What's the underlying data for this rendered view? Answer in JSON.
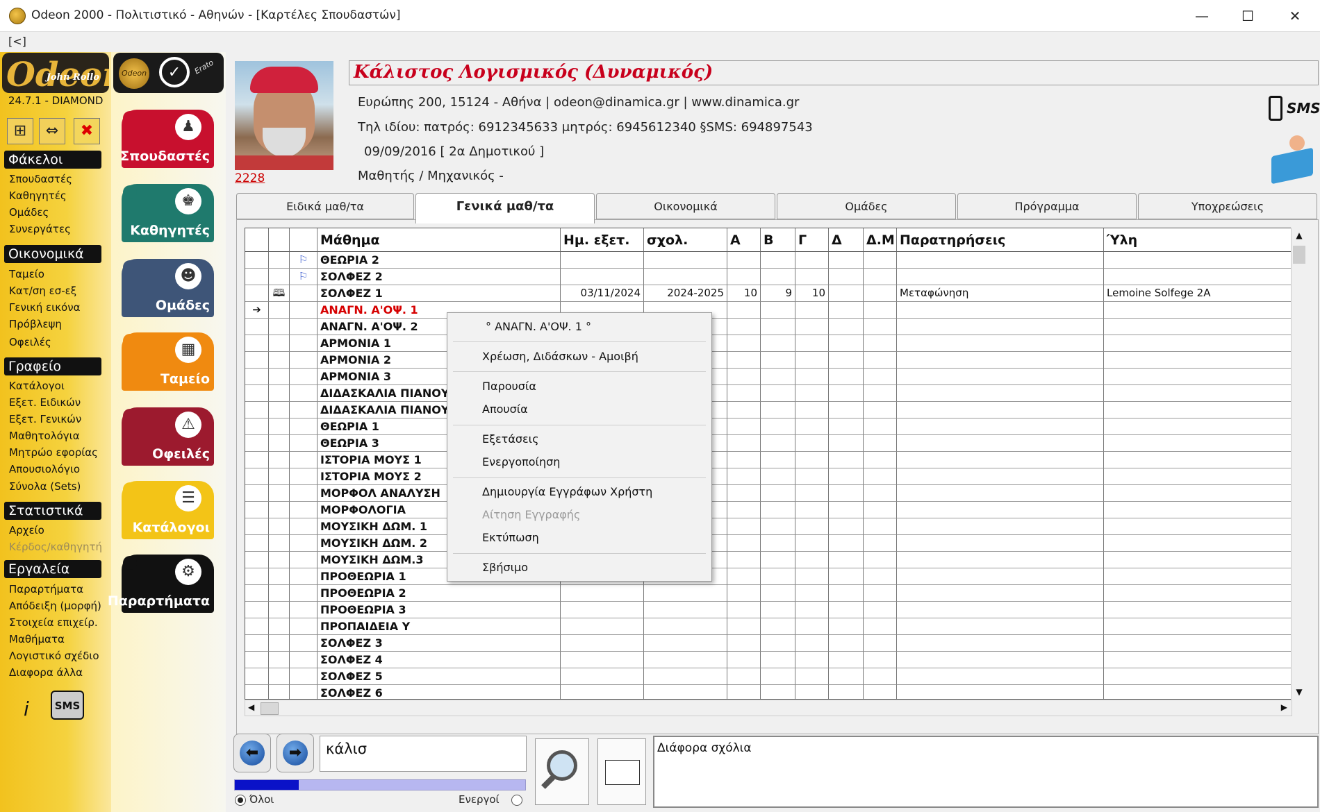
{
  "window": {
    "title": "Odeon 2000 - Πολιτιστικό - Αθηνών - [Καρτέλες Σπουδαστών]",
    "back_strip": "[<]",
    "min": "—",
    "max": "☐",
    "close": "✕"
  },
  "sidebar": {
    "logo": "Odeon",
    "logo_sub": "John Rollo",
    "logo2_coin": "Odeon",
    "logo2_sig": "Erato",
    "version": "24.7.1 - DIAMOND",
    "sections": [
      {
        "title": "Φάκελοι",
        "items": [
          "Σπουδαστές",
          "Καθηγητές",
          "Ομάδες",
          "Συνεργάτες"
        ]
      },
      {
        "title": "Οικονομικά",
        "items": [
          "Ταμείο",
          "Κατ/ση εσ-εξ",
          "Γενική εικόνα",
          "Πρόβλεψη",
          "Οφειλές"
        ]
      },
      {
        "title": "Γραφείο",
        "items": [
          "Κατάλογοι",
          "Εξετ. Ειδικών",
          "Εξετ. Γενικών",
          "Μαθητολόγια",
          "Μητρώο εφορίας",
          "Απουσιολόγιο",
          "Σύνολα (Sets)"
        ]
      },
      {
        "title": "Στατιστικά",
        "items": [
          "Αρχείο",
          "Κέρδος/καθηγητή"
        ]
      },
      {
        "title": "Εργαλεία",
        "items": [
          "Παραρτήματα",
          "Απόδειξη (μορφή)",
          "Στοιχεία επιχείρ.",
          "Μαθήματα",
          "Λογιστικό σχέδιο",
          "Διαφορα άλλα"
        ]
      }
    ],
    "info_icon": "i",
    "sms_label": "SMS"
  },
  "bigbuttons": [
    {
      "label": "Σπουδαστές",
      "color": "#c8102e",
      "glyph": "♟"
    },
    {
      "label": "Καθηγητές",
      "color": "#1f7a6d",
      "glyph": "♚"
    },
    {
      "label": "Ομάδες",
      "color": "#3e5578",
      "glyph": "☻"
    },
    {
      "label": "Ταμείο",
      "color": "#f08a10",
      "glyph": "▦"
    },
    {
      "label": "Οφειλές",
      "color": "#9c1a2e",
      "glyph": "⚠"
    },
    {
      "label": "Κατάλογοι",
      "color": "#f3c417",
      "glyph": "☰"
    },
    {
      "label": "Παραρτήματα",
      "color": "#111111",
      "glyph": "⚙"
    }
  ],
  "student": {
    "id": "2228",
    "name": "Κάλιστος Λογισμικός (Δυναμικός)",
    "address": "Ευρώπης 200, 15124 - Αθήνα | odeon@dinamica.gr | www.dinamica.gr",
    "phones": "Τηλ ιδίου:  πατρός: 6912345633 μητρός: 6945612340 §SMS: 694897543",
    "date": "09/09/2016 [ 2α Δημοτικού ]",
    "occupation": "Μαθητής / Μηχανικός -",
    "sms_badge": "SMS"
  },
  "tabs": [
    "Ειδικά μαθ/τα",
    "Γενικά μαθ/τα",
    "Οικονομικά",
    "Ομάδες",
    "Πρόγραμμα",
    "Υποχρεώσεις"
  ],
  "grid": {
    "headers": [
      "Μάθημα",
      "Ημ. εξετ.",
      "σχολ.",
      "Α",
      "Β",
      "Γ",
      "Δ",
      "Δ.Μ",
      "Παρατηρήσεις",
      "Ύλη"
    ],
    "rows": [
      {
        "subject": "ΘΕΩΡΙΑ 2",
        "flag": "⚐",
        "marker": "",
        "date": "",
        "school": "",
        "a": "",
        "b": "",
        "g": "",
        "notes": "",
        "material": "",
        "red": false
      },
      {
        "subject": "ΣΟΛΦΕΖ 2",
        "flag": "⚐",
        "marker": "",
        "date": "",
        "school": "",
        "a": "",
        "b": "",
        "g": "",
        "notes": "",
        "material": "",
        "red": false
      },
      {
        "subject": "ΣΟΛΦΕΖ 1",
        "flag": "",
        "marker": "🕮",
        "date": "03/11/2024",
        "school": "2024-2025",
        "a": "10",
        "b": "9",
        "g": "10",
        "notes": "Μεταφώνηση",
        "material": "Lemoine Solfege 2A",
        "red": false
      },
      {
        "subject": "ΑΝΑΓΝ. Α'ΟΨ. 1",
        "flag": "",
        "marker": "",
        "arrow": "➔",
        "date": "",
        "school": "",
        "a": "",
        "b": "",
        "g": "",
        "notes": "",
        "material": "",
        "red": true
      },
      {
        "subject": "ΑΝΑΓΝ. Α'ΟΨ. 2",
        "flag": "",
        "marker": "",
        "date": "",
        "school": "",
        "a": "",
        "b": "",
        "g": "",
        "notes": "",
        "material": "",
        "red": false
      },
      {
        "subject": "ΑΡΜΟΝΙΑ 1",
        "flag": "",
        "marker": "",
        "date": "",
        "school": "",
        "a": "",
        "b": "",
        "g": "",
        "notes": "",
        "material": "",
        "red": false
      },
      {
        "subject": "ΑΡΜΟΝΙΑ 2",
        "flag": "",
        "marker": "",
        "date": "",
        "school": "",
        "a": "",
        "b": "",
        "g": "",
        "notes": "",
        "material": "",
        "red": false
      },
      {
        "subject": "ΑΡΜΟΝΙΑ 3",
        "flag": "",
        "marker": "",
        "date": "",
        "school": "",
        "a": "",
        "b": "",
        "g": "",
        "notes": "",
        "material": "",
        "red": false
      },
      {
        "subject": "ΔΙΔΑΣΚΑΛΙΑ ΠΙΑΝΟΥ",
        "flag": "",
        "marker": "",
        "date": "",
        "school": "",
        "a": "",
        "b": "",
        "g": "",
        "notes": "",
        "material": "",
        "red": false
      },
      {
        "subject": "ΔΙΔΑΣΚΑΛΙΑ ΠΙΑΝΟΥ",
        "flag": "",
        "marker": "",
        "date": "",
        "school": "",
        "a": "",
        "b": "",
        "g": "",
        "notes": "",
        "material": "",
        "red": false
      },
      {
        "subject": "ΘΕΩΡΙΑ 1",
        "flag": "",
        "marker": "",
        "date": "",
        "school": "",
        "a": "",
        "b": "",
        "g": "",
        "notes": "",
        "material": "",
        "red": false
      },
      {
        "subject": "ΘΕΩΡΙΑ 3",
        "flag": "",
        "marker": "",
        "date": "",
        "school": "",
        "a": "",
        "b": "",
        "g": "",
        "notes": "",
        "material": "",
        "red": false
      },
      {
        "subject": "ΙΣΤΟΡΙΑ ΜΟΥΣ 1",
        "flag": "",
        "marker": "",
        "date": "",
        "school": "",
        "a": "",
        "b": "",
        "g": "",
        "notes": "",
        "material": "",
        "red": false
      },
      {
        "subject": "ΙΣΤΟΡΙΑ ΜΟΥΣ 2",
        "flag": "",
        "marker": "",
        "date": "",
        "school": "",
        "a": "",
        "b": "",
        "g": "",
        "notes": "",
        "material": "",
        "red": false
      },
      {
        "subject": "ΜΟΡΦΟΛ ΑΝΑΛΥΣΗ",
        "flag": "",
        "marker": "",
        "date": "",
        "school": "",
        "a": "",
        "b": "",
        "g": "",
        "notes": "",
        "material": "",
        "red": false
      },
      {
        "subject": "ΜΟΡΦΟΛΟΓΙΑ",
        "flag": "",
        "marker": "",
        "date": "",
        "school": "",
        "a": "",
        "b": "",
        "g": "",
        "notes": "",
        "material": "",
        "red": false
      },
      {
        "subject": "ΜΟΥΣΙΚΗ ΔΩΜ. 1",
        "flag": "",
        "marker": "",
        "date": "",
        "school": "",
        "a": "",
        "b": "",
        "g": "",
        "notes": "",
        "material": "",
        "red": false
      },
      {
        "subject": "ΜΟΥΣΙΚΗ ΔΩΜ. 2",
        "flag": "",
        "marker": "",
        "date": "",
        "school": "",
        "a": "",
        "b": "",
        "g": "",
        "notes": "",
        "material": "",
        "red": false
      },
      {
        "subject": "ΜΟΥΣΙΚΗ ΔΩΜ.3",
        "flag": "",
        "marker": "",
        "date": "",
        "school": "",
        "a": "",
        "b": "",
        "g": "",
        "notes": "",
        "material": "",
        "red": false
      },
      {
        "subject": "ΠΡΟΘΕΩΡΙΑ 1",
        "flag": "",
        "marker": "",
        "date": "",
        "school": "",
        "a": "",
        "b": "",
        "g": "",
        "notes": "",
        "material": "",
        "red": false
      },
      {
        "subject": "ΠΡΟΘΕΩΡΙΑ 2",
        "flag": "",
        "marker": "",
        "date": "",
        "school": "",
        "a": "",
        "b": "",
        "g": "",
        "notes": "",
        "material": "",
        "red": false
      },
      {
        "subject": "ΠΡΟΘΕΩΡΙΑ 3",
        "flag": "",
        "marker": "",
        "date": "",
        "school": "",
        "a": "",
        "b": "",
        "g": "",
        "notes": "",
        "material": "",
        "red": false
      },
      {
        "subject": "ΠΡΟΠΑΙΔΕΙΑ Υ",
        "flag": "",
        "marker": "",
        "date": "",
        "school": "",
        "a": "",
        "b": "",
        "g": "",
        "notes": "",
        "material": "",
        "red": false
      },
      {
        "subject": "ΣΟΛΦΕΖ 3",
        "flag": "",
        "marker": "",
        "date": "",
        "school": "",
        "a": "",
        "b": "",
        "g": "",
        "notes": "",
        "material": "",
        "red": false
      },
      {
        "subject": "ΣΟΛΦΕΖ 4",
        "flag": "",
        "marker": "",
        "date": "",
        "school": "",
        "a": "",
        "b": "",
        "g": "",
        "notes": "",
        "material": "",
        "red": false
      },
      {
        "subject": "ΣΟΛΦΕΖ 5",
        "flag": "",
        "marker": "",
        "date": "",
        "school": "",
        "a": "",
        "b": "",
        "g": "",
        "notes": "",
        "material": "",
        "red": false
      },
      {
        "subject": "ΣΟΛΦΕΖ 6",
        "flag": "",
        "marker": "",
        "date": "",
        "school": "",
        "a": "",
        "b": "",
        "g": "",
        "notes": "",
        "material": "",
        "red": false
      }
    ]
  },
  "context_menu": {
    "header": "° ΑΝΑΓΝ. Α'ΟΨ. 1 °",
    "items": [
      {
        "label": "Χρέωση, Διδάσκων - Αμοιβή",
        "disabled": false
      },
      {
        "label": "Παρουσία",
        "disabled": false
      },
      {
        "label": "Απουσία",
        "disabled": false
      },
      {
        "label": "Εξετάσεις",
        "disabled": false
      },
      {
        "label": "Ενεργοποίηση",
        "disabled": false
      },
      {
        "label": "Δημιουργία Εγγράφων Χρήστη",
        "disabled": false
      },
      {
        "label": "Αίτηση Εγγραφής",
        "disabled": true
      },
      {
        "label": "Εκτύπωση",
        "disabled": false
      },
      {
        "label": "Σβήσιμο",
        "disabled": false
      }
    ]
  },
  "bottom": {
    "prev": "⬅",
    "next": "➡",
    "search_value": "κάλισ",
    "progress": 0.22,
    "radio_all": "Όλοι",
    "radio_active": "Ενεργοί",
    "notes_label": "Διάφορα σχόλια"
  },
  "colors": {
    "accent_red": "#c8001c",
    "sidebar_yellow": "#f2c21e",
    "progress_fill": "#0a12c8"
  }
}
